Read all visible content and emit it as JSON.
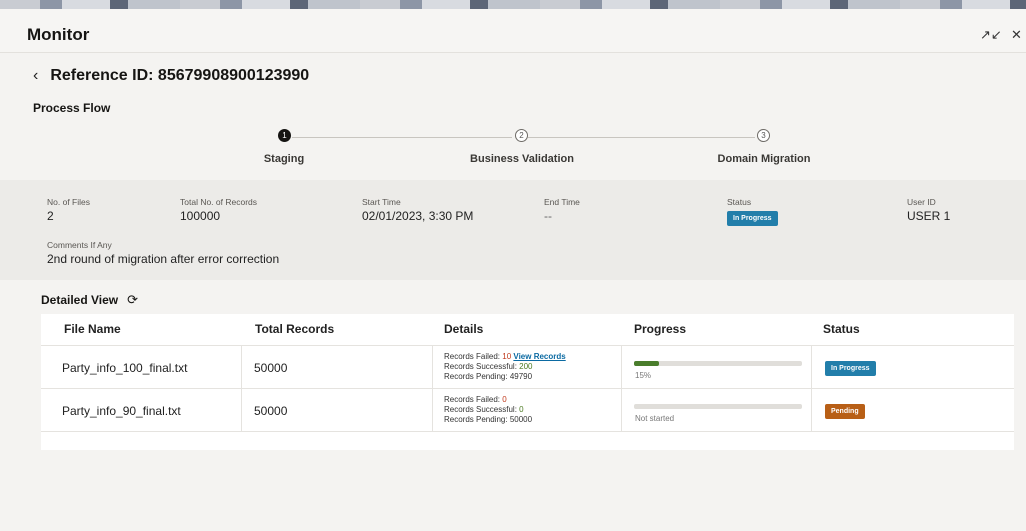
{
  "app": {
    "title": "Monitor"
  },
  "window": {
    "minimize_glyph": "↗↙",
    "close_glyph": "✕"
  },
  "reference": {
    "back_glyph": "‹",
    "title": "Reference ID: 85679908900123990"
  },
  "process_flow": {
    "title": "Process Flow",
    "steps": [
      {
        "number": "1",
        "label": "Staging",
        "active": true
      },
      {
        "number": "2",
        "label": "Business Validation",
        "active": false
      },
      {
        "number": "3",
        "label": "Domain Migration",
        "active": false
      }
    ]
  },
  "summary": {
    "files_label": "No. of Files",
    "files_value": "2",
    "records_label": "Total No. of Records",
    "records_value": "100000",
    "start_label": "Start Time",
    "start_value": "02/01/2023, 3:30 PM",
    "end_label": "End Time",
    "end_value": "--",
    "status_label": "Status",
    "status_value": "In Progress",
    "user_label": "User ID",
    "user_value": "USER 1",
    "comments_label": "Comments If Any",
    "comments_value": "2nd round of migration after error correction"
  },
  "detailed_view": {
    "title": "Detailed View",
    "refresh_glyph": "⟳",
    "columns": [
      "File Name",
      "Total Records",
      "Details",
      "Progress",
      "Status"
    ],
    "rows": [
      {
        "file": "Party_info_100_final.txt",
        "total": "50000",
        "failed_label": "Records Failed: ",
        "failed_value": "10",
        "view_link": "View Records",
        "success_label": "Records Successful: ",
        "success_value": "200",
        "pending_label": "Records Pending: ",
        "pending_value": "49790",
        "progress_percent": 15,
        "progress_text": "15%",
        "status": "In Progress"
      },
      {
        "file": "Party_info_90_final.txt",
        "total": "50000",
        "failed_label": "Records Failed: ",
        "failed_value": "0",
        "success_label": "Records Successful: ",
        "success_value": "0",
        "pending_label": "Records Pending: ",
        "pending_value": "50000",
        "progress_percent": 0,
        "progress_text": "Not started",
        "status": "Pending"
      }
    ]
  },
  "colors": {
    "in_progress": "#227eaa",
    "pending": "#b85f16",
    "progress_fill": "#4a7d2c",
    "failed": "#c03a1d",
    "success": "#4b7a21",
    "link": "#0b6aa2"
  }
}
